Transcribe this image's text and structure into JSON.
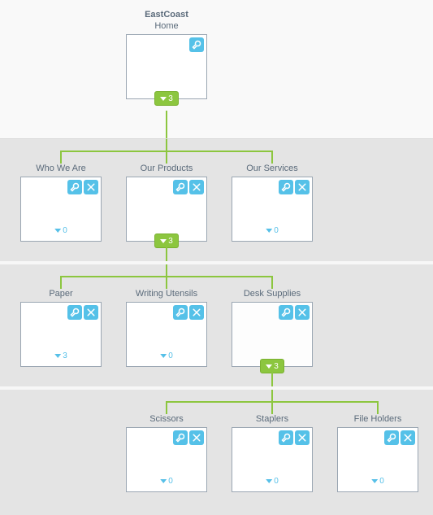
{
  "colors": {
    "accent": "#55c1e8",
    "connector": "#8cc63f",
    "text": "#5a6a7a"
  },
  "icons": {
    "wrench": "wrench-icon",
    "close": "close-icon",
    "expand": "arrow-down-icon"
  },
  "root": {
    "title": "EastCoast",
    "subtitle": "Home",
    "child_count": "3",
    "has_close": false,
    "expanded": true
  },
  "level1": [
    {
      "label": "Who We Are",
      "child_count": "0",
      "expanded": false
    },
    {
      "label": "Our Products",
      "child_count": "3",
      "expanded": true
    },
    {
      "label": "Our Services",
      "child_count": "0",
      "expanded": false
    }
  ],
  "level2": [
    {
      "label": "Paper",
      "child_count": "3",
      "expanded": false
    },
    {
      "label": "Writing Utensils",
      "child_count": "0",
      "expanded": false
    },
    {
      "label": "Desk Supplies",
      "child_count": "3",
      "expanded": true,
      "selected": true
    }
  ],
  "level3": [
    {
      "label": "Scissors",
      "child_count": "0",
      "expanded": false
    },
    {
      "label": "Staplers",
      "child_count": "0",
      "expanded": false
    },
    {
      "label": "File Holders",
      "child_count": "0",
      "expanded": false
    }
  ]
}
